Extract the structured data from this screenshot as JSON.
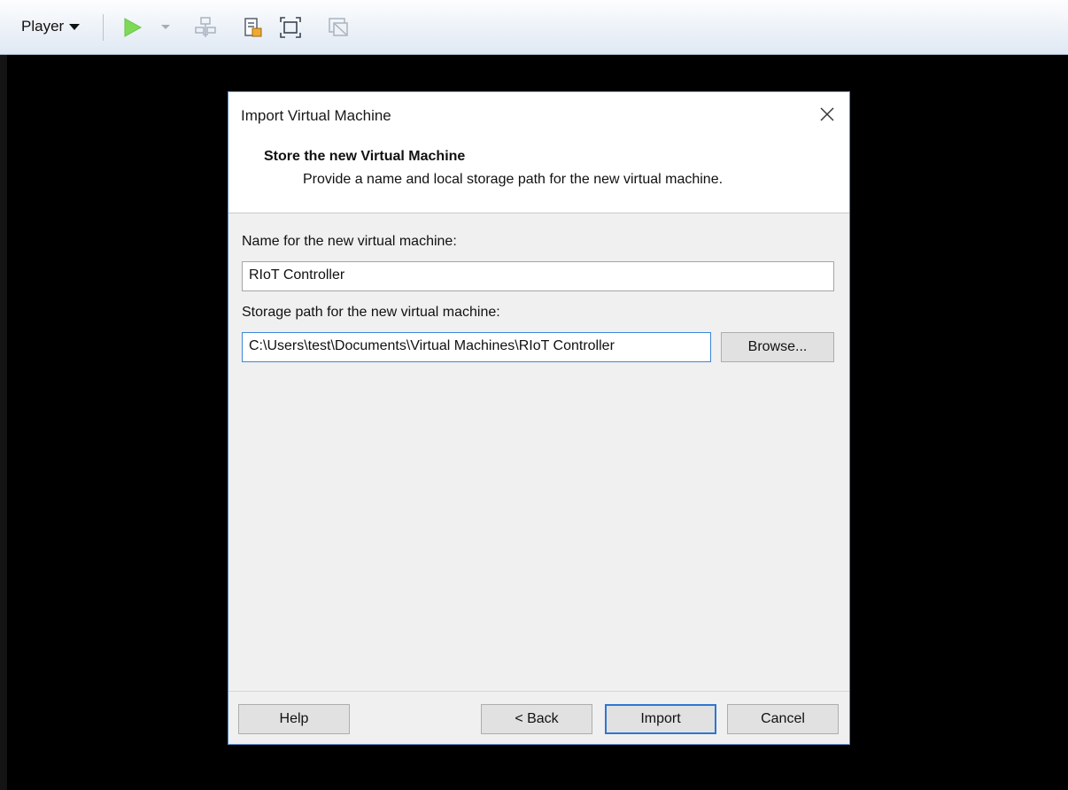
{
  "toolbar": {
    "player_label": "Player",
    "icons": [
      "play-icon",
      "play-dropdown-icon",
      "network-icon",
      "removable-devices-icon",
      "fullscreen-icon",
      "unity-icon"
    ]
  },
  "dialog": {
    "title": "Import Virtual Machine",
    "step_title": "Store the new Virtual Machine",
    "step_description": "Provide a name and local storage path for the new virtual machine.",
    "name_label": "Name for the new virtual machine:",
    "name_value": "RIoT Controller",
    "path_label": "Storage path for the new virtual machine:",
    "path_value": "C:\\Users\\test\\Documents\\Virtual Machines\\RIoT Controller",
    "browse_label": "Browse...",
    "buttons": {
      "help": "Help",
      "back": "< Back",
      "import": "Import",
      "cancel": "Cancel"
    }
  },
  "colors": {
    "accent": "#3c87d6",
    "dialog_border": "#5b8bc9",
    "play_green": "#7ed957"
  }
}
